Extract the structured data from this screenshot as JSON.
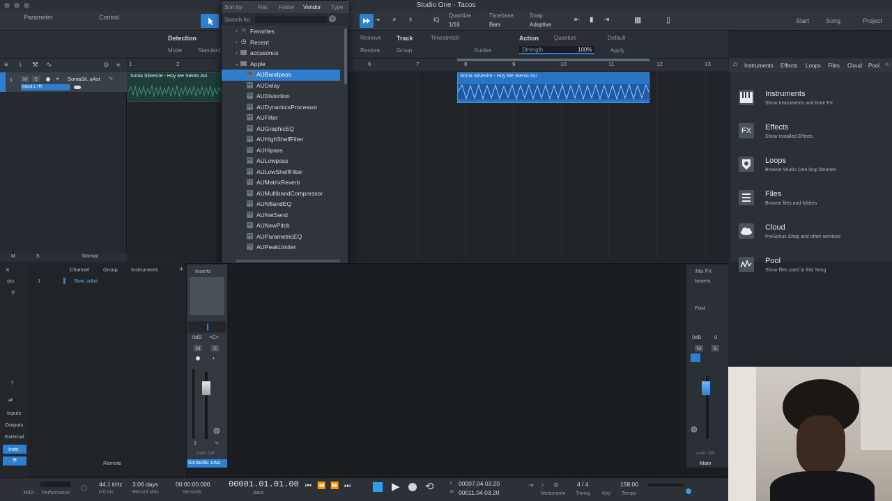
{
  "window": {
    "title": "Studio One - Tacos"
  },
  "toolbar": {
    "parameter": "Parameter",
    "control": "Control",
    "quantize_label": "Quantize",
    "quantize_value": "1/16",
    "timebase_label": "Timebase",
    "timebase_value": "Bars",
    "snap_label": "Snap",
    "snap_value": "Adaptive",
    "start": "Start",
    "song": "Song",
    "project": "Project"
  },
  "inspector": {
    "detection": "Detection",
    "mode": "Mode",
    "standard": "Standard",
    "remove": "Remove",
    "restore": "Restore",
    "track": "Track",
    "group": "Group",
    "timestretch": "Timestretch",
    "guides": "Guides",
    "action": "Action",
    "strength": "Strength",
    "strength_value": "100%",
    "quantize": "Quantize",
    "default": "Default",
    "apply": "Apply"
  },
  "track": {
    "number": "1",
    "m": "M",
    "s": "S",
    "name": "SoniaSil..oAsi",
    "input": "Input L+R",
    "footer_m": "M",
    "footer_s": "S",
    "footer_mode": "Normal"
  },
  "ruler": [
    "1",
    "2",
    "6",
    "7",
    "8",
    "9",
    "10",
    "11",
    "12",
    "13"
  ],
  "clips": {
    "clip1_name": "Sonia Silvestre - Hoy Me Siento Asi",
    "clip2_name": "Sonia Silvestre - Hoy Me Siento Asi"
  },
  "dropdown": {
    "sort_by": "Sort by:",
    "flat": "Flat",
    "folder": "Folder",
    "vendor": "Vendor",
    "type": "Type",
    "search_label": "Search for",
    "favorites": "Favorites",
    "recent": "Recent",
    "accusonus": "accusonus",
    "apple": "Apple",
    "fx_badge": "FX",
    "items": [
      "AUBandpass",
      "AUDelay",
      "AUDistortion",
      "AUDynamicsProcessor",
      "AUFilter",
      "AUGraphicEQ",
      "AUHighShelfFilter",
      "AUHipass",
      "AULowpass",
      "AULowShelfFilter",
      "AUMatrixReverb",
      "AUMultibandCompressor",
      "AUNBandEQ",
      "AUNetSend",
      "AUNewPitch",
      "AUParametricEQ",
      "AUPeakLimiter"
    ],
    "selected_index": 0
  },
  "browser": {
    "tabs": [
      "Instruments",
      "Effects",
      "Loops",
      "Files",
      "Cloud",
      "Pool"
    ],
    "items": [
      {
        "title": "Instruments",
        "subtitle": "Show Instruments and Note FX",
        "icon": "piano-icon"
      },
      {
        "title": "Effects",
        "subtitle": "Show installed Effects",
        "icon": "fx-icon"
      },
      {
        "title": "Loops",
        "subtitle": "Browse Studio One loop libraries",
        "icon": "loops-icon"
      },
      {
        "title": "Files",
        "subtitle": "Browse files and folders",
        "icon": "files-icon"
      },
      {
        "title": "Cloud",
        "subtitle": "PreSonus Shop and other services",
        "icon": "cloud-icon"
      },
      {
        "title": "Pool",
        "subtitle": "Show files used in this Song",
        "icon": "pool-icon"
      }
    ],
    "fx_glyph": "FX"
  },
  "console": {
    "io": "I/O",
    "channel": "Channel",
    "group": "Group",
    "instruments": "Instruments",
    "inserts": "Inserts",
    "channel_number": "1",
    "channel_name": "Soni..oAsi",
    "inputs": "Inputs",
    "outputs": "Outputs",
    "external": "External",
    "instr": "Instr.",
    "remote": "Remote",
    "strip_db": "0dB",
    "strip_pan": "<C>",
    "strip_m": "M",
    "strip_s": "S",
    "strip_num": "1",
    "auto_off": "Auto: Off",
    "strip_name": "SoniaSilv..oAsi",
    "mix_fx": "Mix FX",
    "post": "Post",
    "main_db": "0dB",
    "main_pan": "0",
    "main_m": "M",
    "main_s": "S",
    "main_auto": "Auto: Off",
    "main": "Main"
  },
  "transport": {
    "midi": "MIDI",
    "performance": "Performance",
    "sample_rate": "44.1 kHz",
    "latency": "0.0 ms",
    "record_days": "3:06 days",
    "record_max": "Record Max",
    "seconds_value": "00:00:00.000",
    "seconds": "Seconds",
    "bars_value": "00001.01.01.00",
    "bars": "Bars",
    "loop_l_label": "L",
    "loop_l": "00007.04.03.20",
    "loop_r_label": "R",
    "loop_r": "00011.04.03.20",
    "metronome": "Metronome",
    "timing_value": "4 / 4",
    "timing": "Timing",
    "key": "Key",
    "tempo_value": "158.00",
    "tempo": "Tempo"
  }
}
